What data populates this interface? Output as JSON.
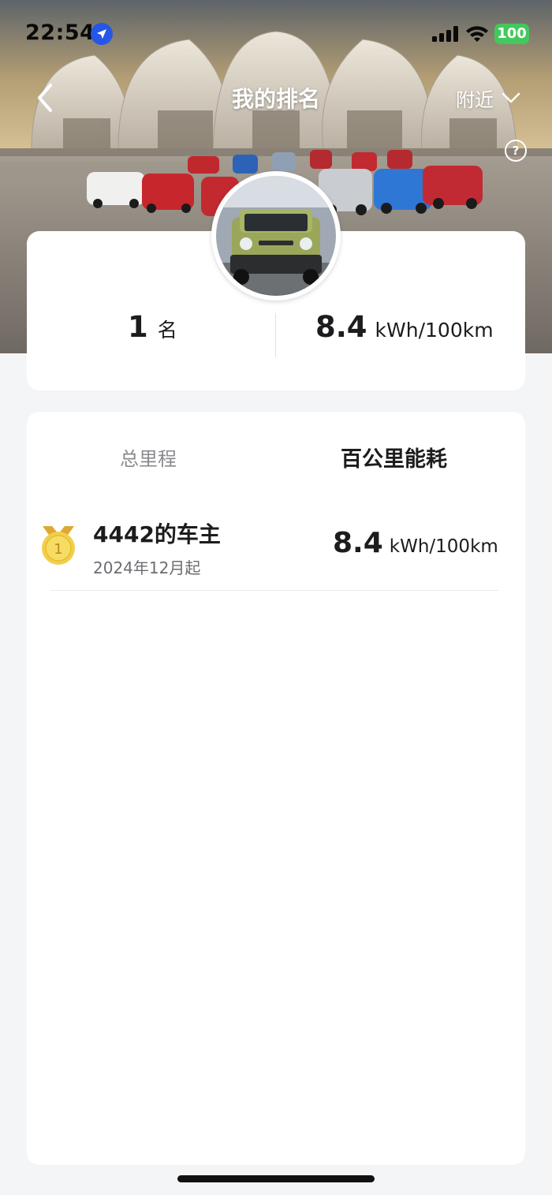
{
  "status_bar": {
    "time": "22:54",
    "battery": "100",
    "location_icon": "location-arrow-icon",
    "signal_icon": "cellular-signal-icon",
    "wifi_icon": "wifi-icon"
  },
  "nav": {
    "title": "我的排名",
    "region": "附近",
    "back_icon": "chevron-left-icon",
    "dropdown_icon": "chevron-down-icon",
    "help_icon": "question-circle-icon",
    "help_glyph": "?"
  },
  "rank_card": {
    "rank_number": "1",
    "rank_unit": "名",
    "energy_value": "8.4",
    "energy_unit": "kWh/100km"
  },
  "tabs": [
    {
      "label": "总里程",
      "active": false
    },
    {
      "label": "百公里能耗",
      "active": true
    }
  ],
  "rankings": [
    {
      "rank": "1",
      "name": "4442的车主",
      "since": "2024年12月起",
      "value": "8.4",
      "unit": "kWh/100km",
      "medal": "gold-medal-icon"
    }
  ],
  "colors": {
    "accent_blue": "#2457e6",
    "battery_green": "#43c85b",
    "medal_gold": "#f2cf47",
    "page_bg": "#f4f5f7"
  }
}
